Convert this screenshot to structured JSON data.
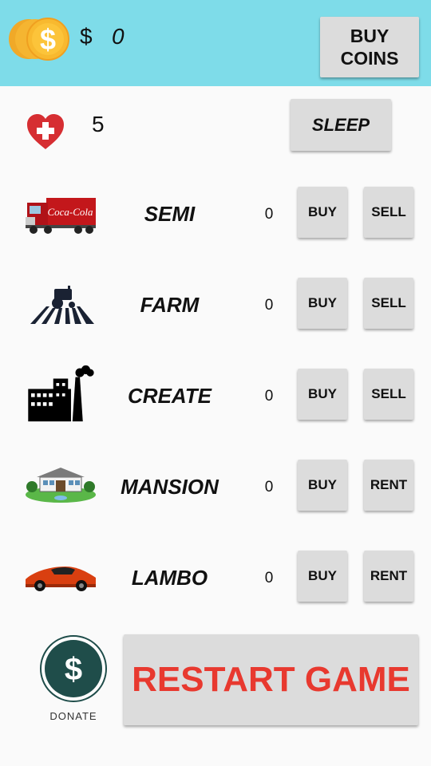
{
  "header": {
    "currency_symbol": "$",
    "coin_amount": "0",
    "buy_coins_label": "BUY COINS",
    "background_color": "#7edce9"
  },
  "status": {
    "health": "5",
    "sleep_label": "SLEEP"
  },
  "assets": [
    {
      "label": "SEMI",
      "count": "0",
      "buy_label": "BUY",
      "action_label": "SELL",
      "icon": "semi-truck-icon"
    },
    {
      "label": "FARM",
      "count": "0",
      "buy_label": "BUY",
      "action_label": "SELL",
      "icon": "tractor-icon"
    },
    {
      "label": "CREATE",
      "count": "0",
      "buy_label": "BUY",
      "action_label": "SELL",
      "icon": "factory-icon"
    },
    {
      "label": "MANSION",
      "count": "0",
      "buy_label": "BUY",
      "action_label": "RENT",
      "icon": "mansion-icon"
    },
    {
      "label": "LAMBO",
      "count": "0",
      "buy_label": "BUY",
      "action_label": "RENT",
      "icon": "sports-car-icon"
    }
  ],
  "footer": {
    "donate_label": "DONATE",
    "restart_label": "RESTART GAME",
    "restart_color": "#e8392f"
  }
}
